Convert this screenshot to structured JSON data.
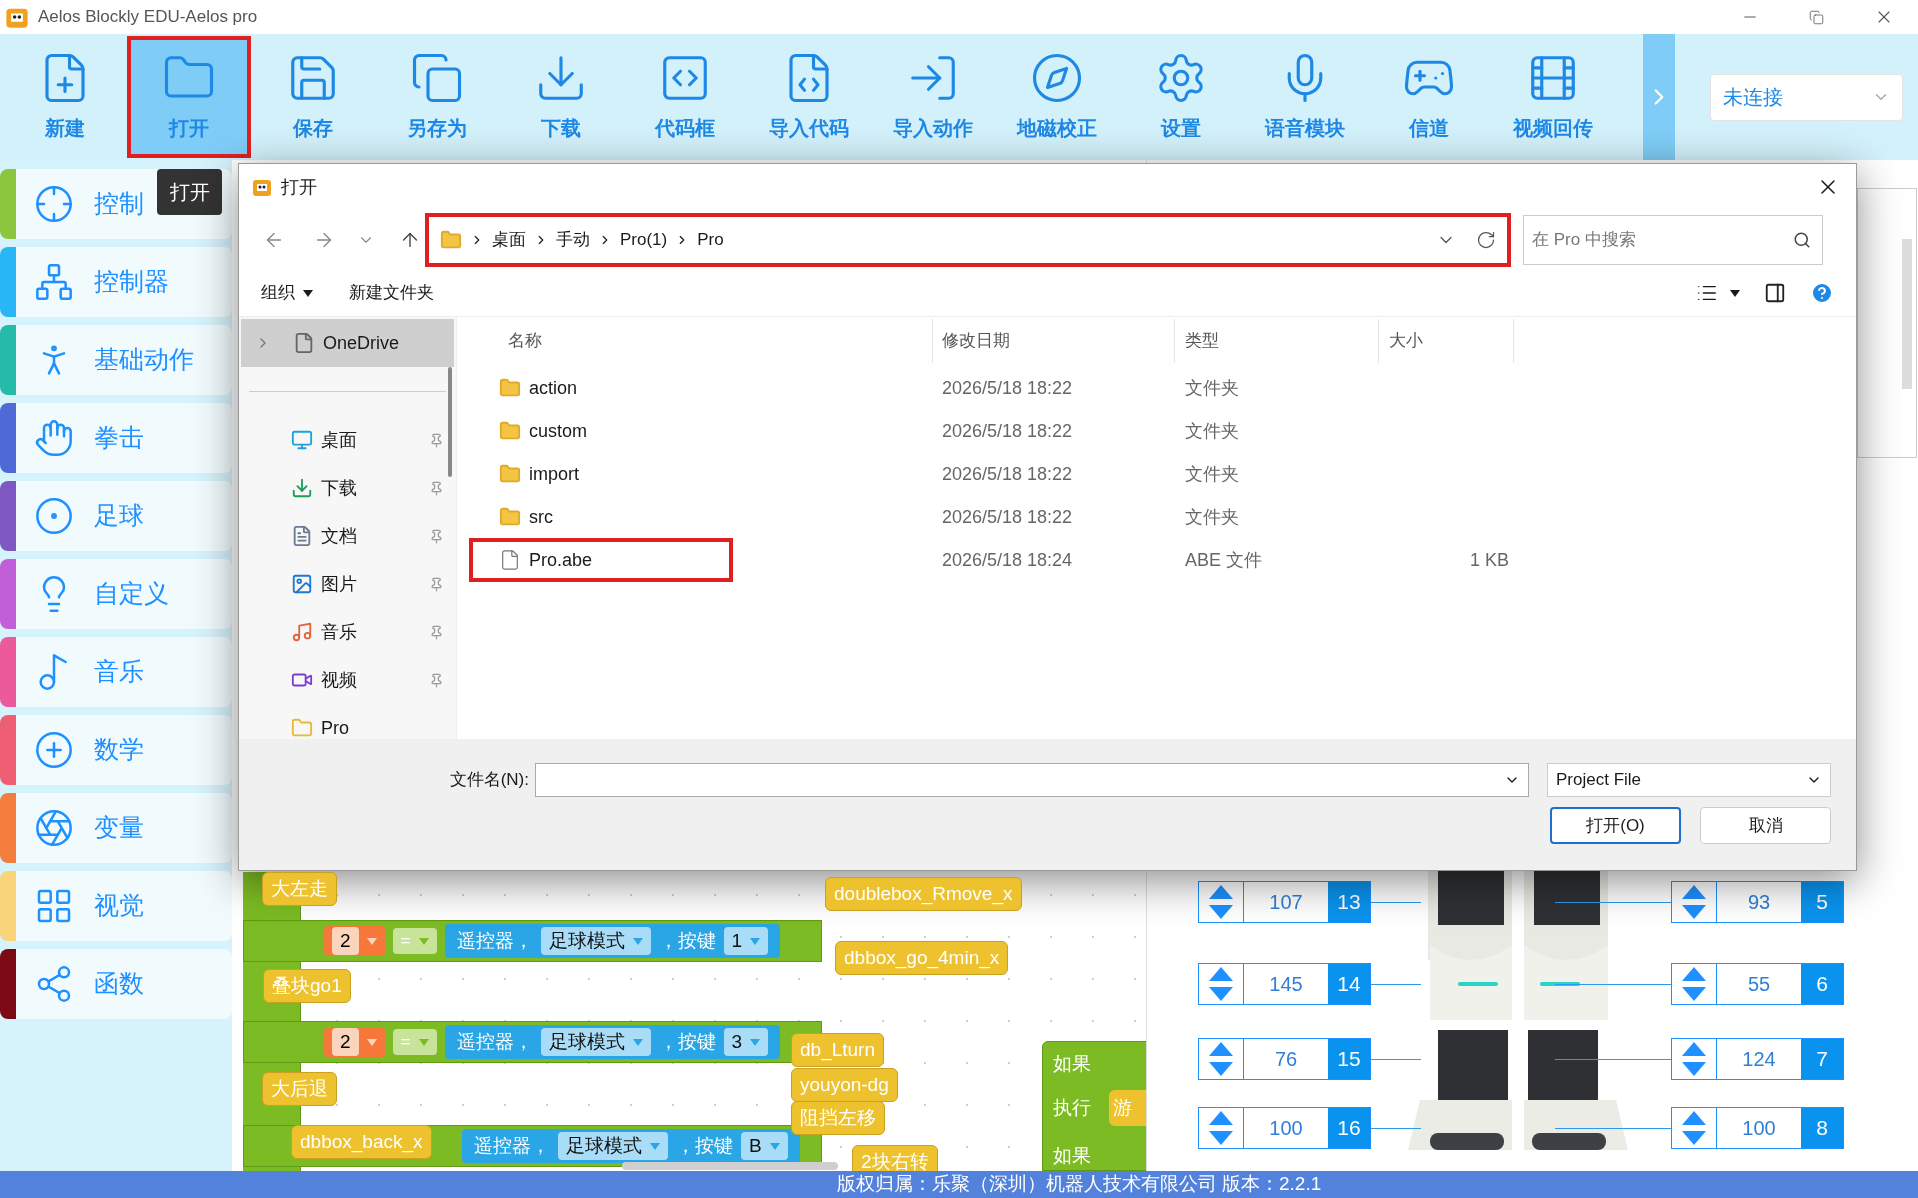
{
  "window": {
    "title": "Aelos Blockly EDU-Aelos pro"
  },
  "toolbar": {
    "items": [
      {
        "label": "新建",
        "selected": false,
        "highlighted": false
      },
      {
        "label": "打开",
        "selected": true,
        "highlighted": true
      },
      {
        "label": "保存",
        "selected": false,
        "highlighted": false
      },
      {
        "label": "另存为",
        "selected": false,
        "highlighted": false
      },
      {
        "label": "下载",
        "selected": false,
        "highlighted": false
      },
      {
        "label": "代码框",
        "selected": false,
        "highlighted": false
      },
      {
        "label": "导入代码",
        "selected": false,
        "highlighted": false
      },
      {
        "label": "导入动作",
        "selected": false,
        "highlighted": false
      },
      {
        "label": "地磁校正",
        "selected": false,
        "highlighted": false
      },
      {
        "label": "设置",
        "selected": false,
        "highlighted": false
      },
      {
        "label": "语音模块",
        "selected": false,
        "highlighted": false
      },
      {
        "label": "信道",
        "selected": false,
        "highlighted": false
      },
      {
        "label": "视频回传",
        "selected": false,
        "highlighted": false
      }
    ],
    "connection": "未连接"
  },
  "tooltip": "打开",
  "sidebar": {
    "items": [
      {
        "label": "控制",
        "color": "#8cc63f"
      },
      {
        "label": "控制器",
        "color": "#29b6f6"
      },
      {
        "label": "基础动作",
        "color": "#26bba8"
      },
      {
        "label": "拳击",
        "color": "#4f6ad6"
      },
      {
        "label": "足球",
        "color": "#7e57c2"
      },
      {
        "label": "自定义",
        "color": "#c05fd8"
      },
      {
        "label": "音乐",
        "color": "#ec5a9c"
      },
      {
        "label": "数学",
        "color": "#ef5f73"
      },
      {
        "label": "变量",
        "color": "#f47e3e"
      },
      {
        "label": "视觉",
        "color": "#f9d47a"
      },
      {
        "label": "函数",
        "color": "#7b0a14"
      }
    ]
  },
  "canvas": {
    "blocks": [
      {
        "kind": "call",
        "text": "大左走"
      },
      {
        "kind": "call",
        "text": "doublebox_Rmove_x"
      },
      {
        "kind": "compare",
        "number": "2",
        "operator": "=",
        "device": "遥控器，",
        "mode": "足球模式",
        "key_label": "，按键",
        "key": "1"
      },
      {
        "kind": "call",
        "text": "dbbox_go_4min_x"
      },
      {
        "kind": "call",
        "text": "叠块go1"
      },
      {
        "kind": "compare",
        "number": "2",
        "operator": "=",
        "device": "遥控器，",
        "mode": "足球模式",
        "key_label": "，按键",
        "key": "3"
      },
      {
        "kind": "call",
        "text": "db_Lturn"
      },
      {
        "kind": "call",
        "text": "大后退"
      },
      {
        "kind": "call",
        "text": "youyon-dg"
      },
      {
        "kind": "call",
        "text": "阻挡左移"
      },
      {
        "kind": "call",
        "text": "dbbox_back_x"
      },
      {
        "kind": "compare",
        "device": "遥控器，",
        "mode": "足球模式",
        "key_label": "，按键",
        "key": "B"
      },
      {
        "kind": "call",
        "text": "2块右转"
      },
      {
        "kind": "if",
        "if_label": "如果",
        "do_label": "执行",
        "call": "游",
        "next_label": "如果"
      }
    ]
  },
  "servos": [
    {
      "value": "107",
      "id": "13"
    },
    {
      "value": "145",
      "id": "14"
    },
    {
      "value": "76",
      "id": "15"
    },
    {
      "value": "100",
      "id": "16"
    },
    {
      "value": "93",
      "id": "5"
    },
    {
      "value": "55",
      "id": "6"
    },
    {
      "value": "124",
      "id": "7"
    },
    {
      "value": "100",
      "id": "8"
    }
  ],
  "dialog": {
    "title": "打开",
    "path": [
      "桌面",
      "手动",
      "Pro(1)",
      "Pro"
    ],
    "path_highlighted": true,
    "search": {
      "placeholder": "在 Pro 中搜索"
    },
    "commands": [
      "组织",
      "新建文件夹"
    ],
    "nav_tree": [
      {
        "label": "OneDrive",
        "kind": "cloud",
        "selected": true,
        "pinned": false
      },
      {
        "label": "桌面",
        "kind": "desktop",
        "selected": false,
        "pinned": true
      },
      {
        "label": "下载",
        "kind": "downloads",
        "selected": false,
        "pinned": true
      },
      {
        "label": "文档",
        "kind": "documents",
        "selected": false,
        "pinned": true
      },
      {
        "label": "图片",
        "kind": "pictures",
        "selected": false,
        "pinned": true
      },
      {
        "label": "音乐",
        "kind": "music",
        "selected": false,
        "pinned": true
      },
      {
        "label": "视频",
        "kind": "videos",
        "selected": false,
        "pinned": true
      },
      {
        "label": "Pro",
        "kind": "folder",
        "selected": false,
        "pinned": false
      }
    ],
    "columns": [
      "名称",
      "修改日期",
      "类型",
      "大小"
    ],
    "rows": [
      {
        "kind": "folder",
        "name": "action",
        "modified": "2026/5/18 18:22",
        "type": "文件夹",
        "highlighted": false
      },
      {
        "kind": "folder",
        "name": "custom",
        "modified": "2026/5/18 18:22",
        "type": "文件夹",
        "highlighted": false
      },
      {
        "kind": "folder",
        "name": "import",
        "modified": "2026/5/18 18:22",
        "type": "文件夹",
        "highlighted": false
      },
      {
        "kind": "folder",
        "name": "src",
        "modified": "2026/5/18 18:22",
        "type": "文件夹",
        "highlighted": false
      },
      {
        "kind": "file",
        "name": "Pro.abe",
        "modified": "2026/5/18 18:24",
        "type": "ABE 文件",
        "size": "1 KB",
        "highlighted": true
      }
    ],
    "filename_label": "文件名(N):",
    "file_type": "Project File",
    "buttons": [
      "打开(O)",
      "取消"
    ]
  },
  "status_bar": "版权归属：乐聚（深圳）机器人技术有限公司 版本：2.2.1"
}
